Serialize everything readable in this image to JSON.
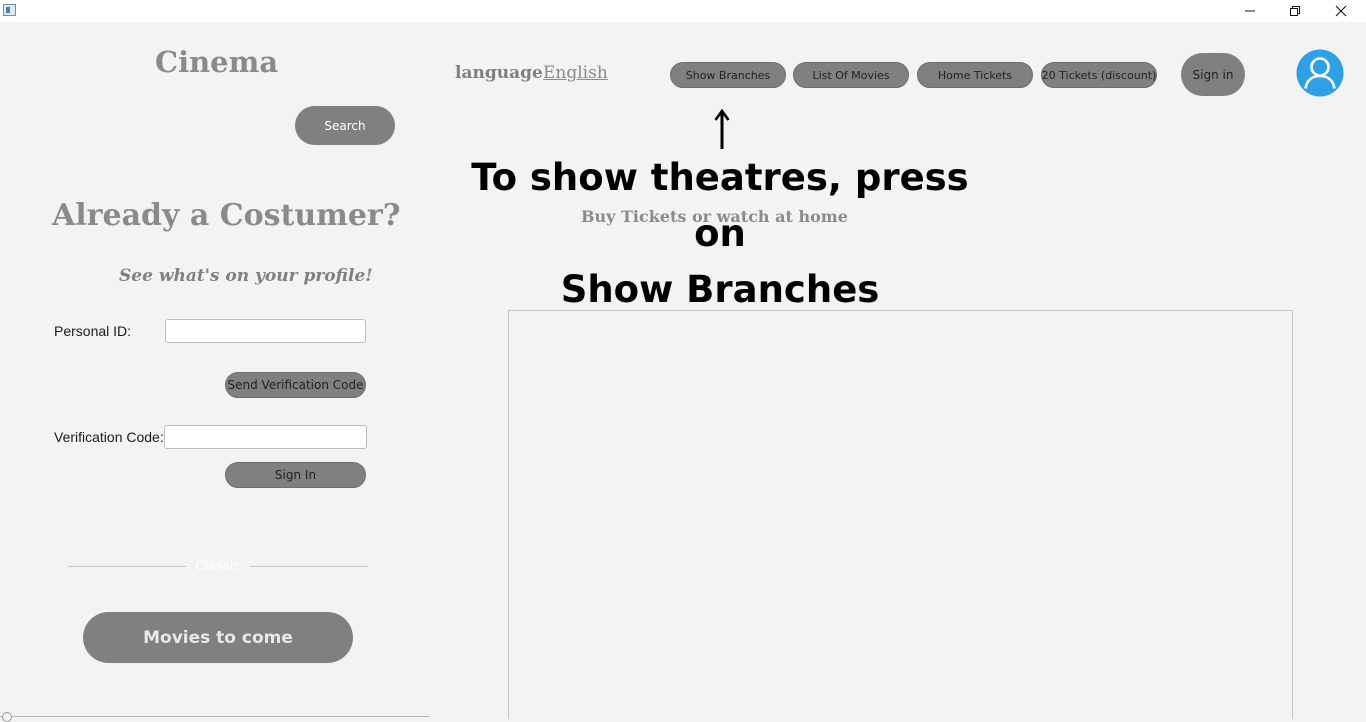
{
  "window": {
    "app_icon": "java-window-icon",
    "controls": {
      "minimize_icon": "minimize-icon",
      "maximize_icon": "restore-icon",
      "close_icon": "close-icon"
    }
  },
  "header": {
    "logo": "Cinema",
    "search_label": "Search",
    "language_label": "language",
    "language_value": "English",
    "nav": [
      {
        "label": "Show Branches"
      },
      {
        "label": "List Of Movies"
      },
      {
        "label": "Home Tickets"
      },
      {
        "label": "20 Tickets (discount)"
      }
    ],
    "signin_label": "Sign in",
    "avatar_icon": "user-avatar-icon",
    "avatar_color": "#2f9fe6"
  },
  "annotation": {
    "arrow_icon": "up-arrow-icon",
    "line1": "To show theatres, press on",
    "line2": "Show Branches"
  },
  "main": {
    "subtitle": "Buy Tickets or watch at home"
  },
  "login": {
    "title": "Already a Costumer?",
    "subtitle": "See what's on your profile!",
    "personal_id_label": "Personal ID:",
    "personal_id_value": "",
    "send_code_label": "Send Verification Code",
    "verification_label": "Verification Code:",
    "verification_value": "",
    "signin_label": "Sign In"
  },
  "sidebar": {
    "classic_label": "Classic",
    "movies_to_come_label": "Movies to come"
  },
  "colors": {
    "background": "#f3f3f3",
    "button": "#808080",
    "heading": "#8a8a8a"
  }
}
